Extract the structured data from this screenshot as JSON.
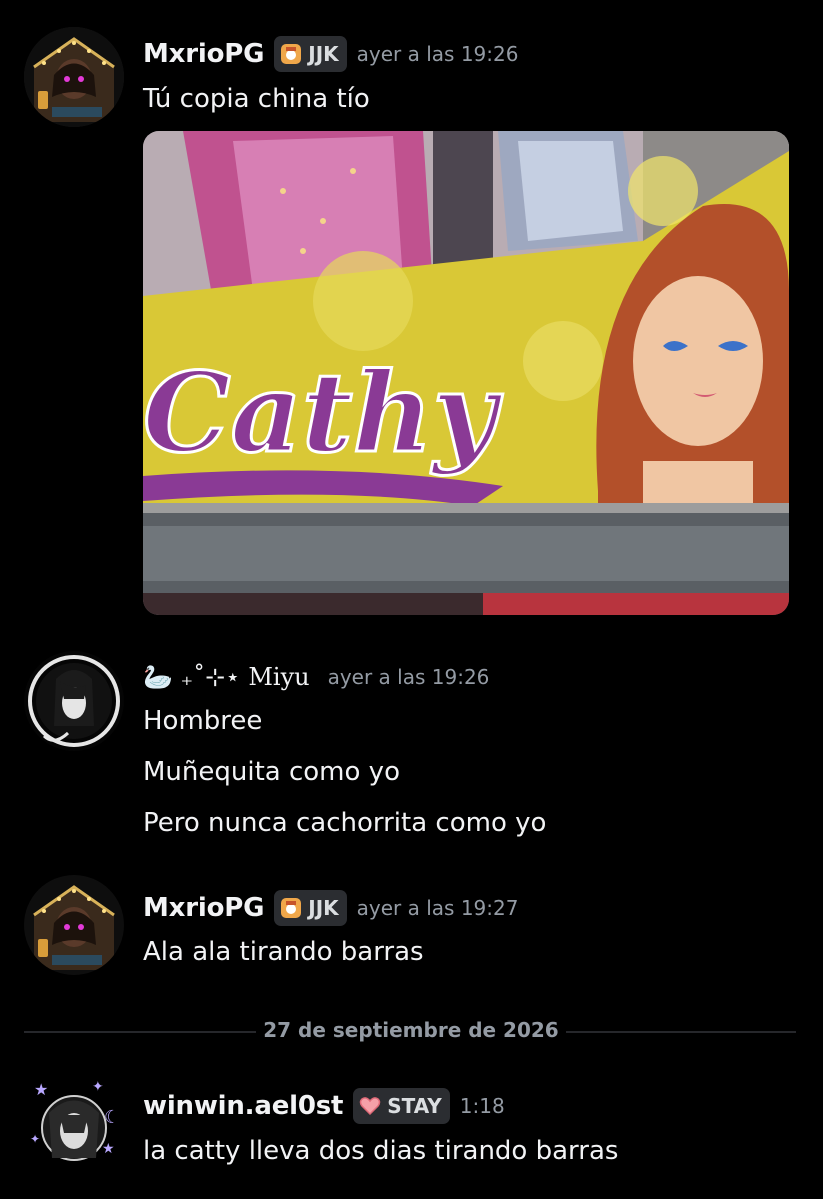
{
  "messages": [
    {
      "author": "MxrioPG",
      "tag": "JJK",
      "timestamp": "ayer a las 19:26",
      "lines": [
        "Tú copia china tío"
      ],
      "attachment": {
        "brand_text": "Cathy"
      }
    },
    {
      "author_prefix": "🦢 ₊˚⊹⋆",
      "author": "Miyu",
      "timestamp": "ayer a las 19:26",
      "lines": [
        "Hombree",
        "Muñequita como yo",
        "Pero nunca cachorrita como yo"
      ]
    },
    {
      "author": "MxrioPG",
      "tag": "JJK",
      "timestamp": "ayer a las 19:27",
      "lines": [
        "Ala ala tirando barras"
      ]
    },
    {
      "author": "winwin.ael0st",
      "tag": "STAY",
      "timestamp": "1:18",
      "lines": [
        "la catty lleva dos dias tirando barras"
      ]
    }
  ],
  "date_divider": "27 de septiembre de 2026",
  "colors": {
    "background": "#000000",
    "text": "#f2f3f5",
    "muted": "#949ba4",
    "tag_bg": "#2b2d31"
  },
  "icons": {
    "jjk_tag": "orange-badge-icon",
    "stay_tag": "pink-heart-icon"
  }
}
